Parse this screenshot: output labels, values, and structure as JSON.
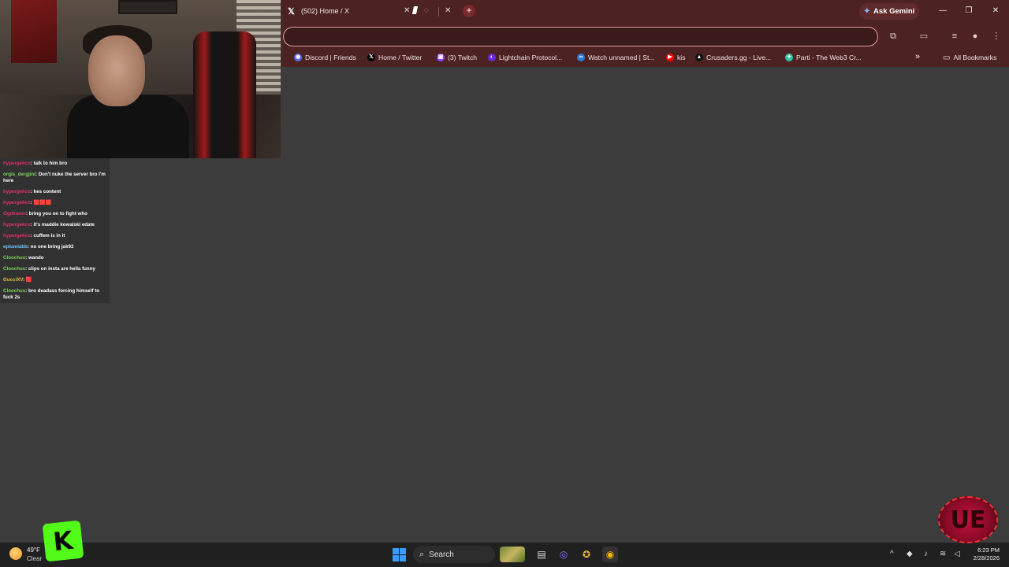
{
  "browser": {
    "active_tab": {
      "title": "(502) Home / X",
      "icon": "x-logo-icon"
    },
    "second_tab": {
      "icon": "loading-icon"
    },
    "gemini_label": "Ask Gemini",
    "new_tab_symbol": "+",
    "window_controls": {
      "minimize": "—",
      "restore": "❐",
      "close": "✕"
    },
    "all_bookmarks_label": "All Bookmarks",
    "more_bookmarks_symbol": "»",
    "bookmarks": [
      {
        "label": "Discord | Friends",
        "icon": "discord-icon",
        "color": "#5865f2"
      },
      {
        "label": "Home / Twitter",
        "icon": "x-logo-icon",
        "color": "#000000"
      },
      {
        "label": "(3) Twitch",
        "icon": "twitch-icon",
        "color": "#9146ff"
      },
      {
        "label": "Lightchain Protocol...",
        "icon": "lightchain-icon",
        "color": "#6a2bd6"
      },
      {
        "label": "Watch unnamed | St...",
        "icon": "watch-icon",
        "color": "#2a7bd8"
      },
      {
        "label": "kis",
        "icon": "youtube-icon",
        "color": "#ff0000"
      },
      {
        "label": "Crusaders.gg - Live...",
        "icon": "crusaders-icon",
        "color": "#111111"
      },
      {
        "label": "Parti - The Web3 Cr...",
        "icon": "parti-icon",
        "color": "#35c0a0"
      }
    ]
  },
  "chat": [
    {
      "user": "hypergekco",
      "user_color": "#e0306a",
      "message": ": talk to him bro"
    },
    {
      "user": "orgis_dergjini",
      "user_color": "#7dd35a",
      "message": ": Don't nuke the server bro I'm here"
    },
    {
      "user": "hypergekco",
      "user_color": "#e0306a",
      "message": ": hes content"
    },
    {
      "user": "hypergekco",
      "user_color": "#e0306a",
      "message": ": 🟥🟥🟥"
    },
    {
      "user": "Ogdkaner",
      "user_color": "#e0306a",
      "message": ": bring you on to fight who"
    },
    {
      "user": "hypergekco",
      "user_color": "#e0306a",
      "message": ": it's maddie kowalski edate"
    },
    {
      "user": "hypergekco",
      "user_color": "#e0306a",
      "message": ": cuffem is in it"
    },
    {
      "user": "eplumiabb",
      "user_color": "#6fc3ff",
      "message": ": no one bring jak92"
    },
    {
      "user": "Cloochus",
      "user_color": "#7dd35a",
      "message": ": wando"
    },
    {
      "user": "Cloochus",
      "user_color": "#7dd35a",
      "message": ": clips on insta are hella funny"
    },
    {
      "user": "GucciXV",
      "user_color": "#e8c040",
      "message": ": 🟥"
    },
    {
      "user": "Cloochus",
      "user_color": "#7dd35a",
      "message": ": bro deadass forcing himself to fuck 2s"
    }
  ],
  "taskbar": {
    "weather": {
      "temp": "49°F",
      "condition": "Clear"
    },
    "search_label": "Search",
    "clock": {
      "time": "6:23 PM",
      "date": "2/28/2026"
    }
  },
  "overlay": {
    "kick_letter": "K",
    "ue_letters": "UE"
  }
}
